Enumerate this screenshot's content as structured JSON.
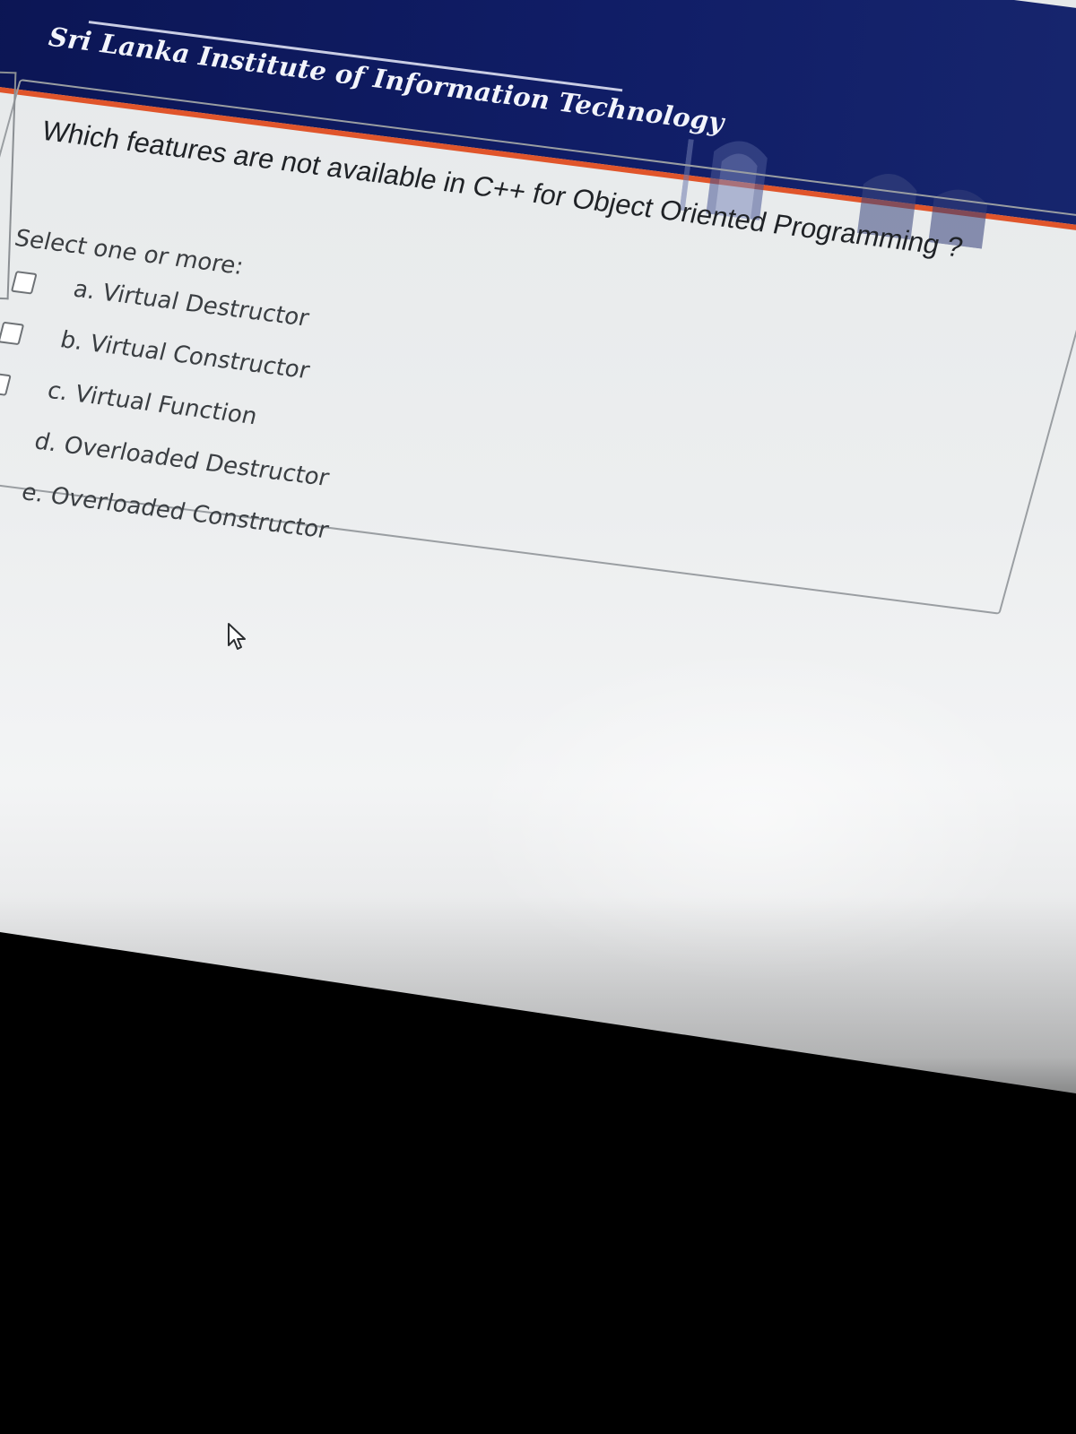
{
  "header": {
    "institution_name": "Sri Lanka Institute of Information Technology",
    "colors": {
      "banner": "#0b1553",
      "accent_stripe": "#e0552b"
    }
  },
  "question": {
    "text": "Which features are not available in C++ for Object Oriented Programming ?",
    "prompt": "Select one or more:",
    "options": [
      {
        "label": "a. Virtual Destructor",
        "checked": false
      },
      {
        "label": "b. Virtual Constructor",
        "checked": false
      },
      {
        "label": "c. Virtual Function",
        "checked": false
      },
      {
        "label": "d. Overloaded Destructor",
        "checked": false
      },
      {
        "label": "e. Overloaded Constructor",
        "checked": false
      }
    ]
  },
  "cursor": {
    "icon": "mouse-pointer-icon"
  }
}
